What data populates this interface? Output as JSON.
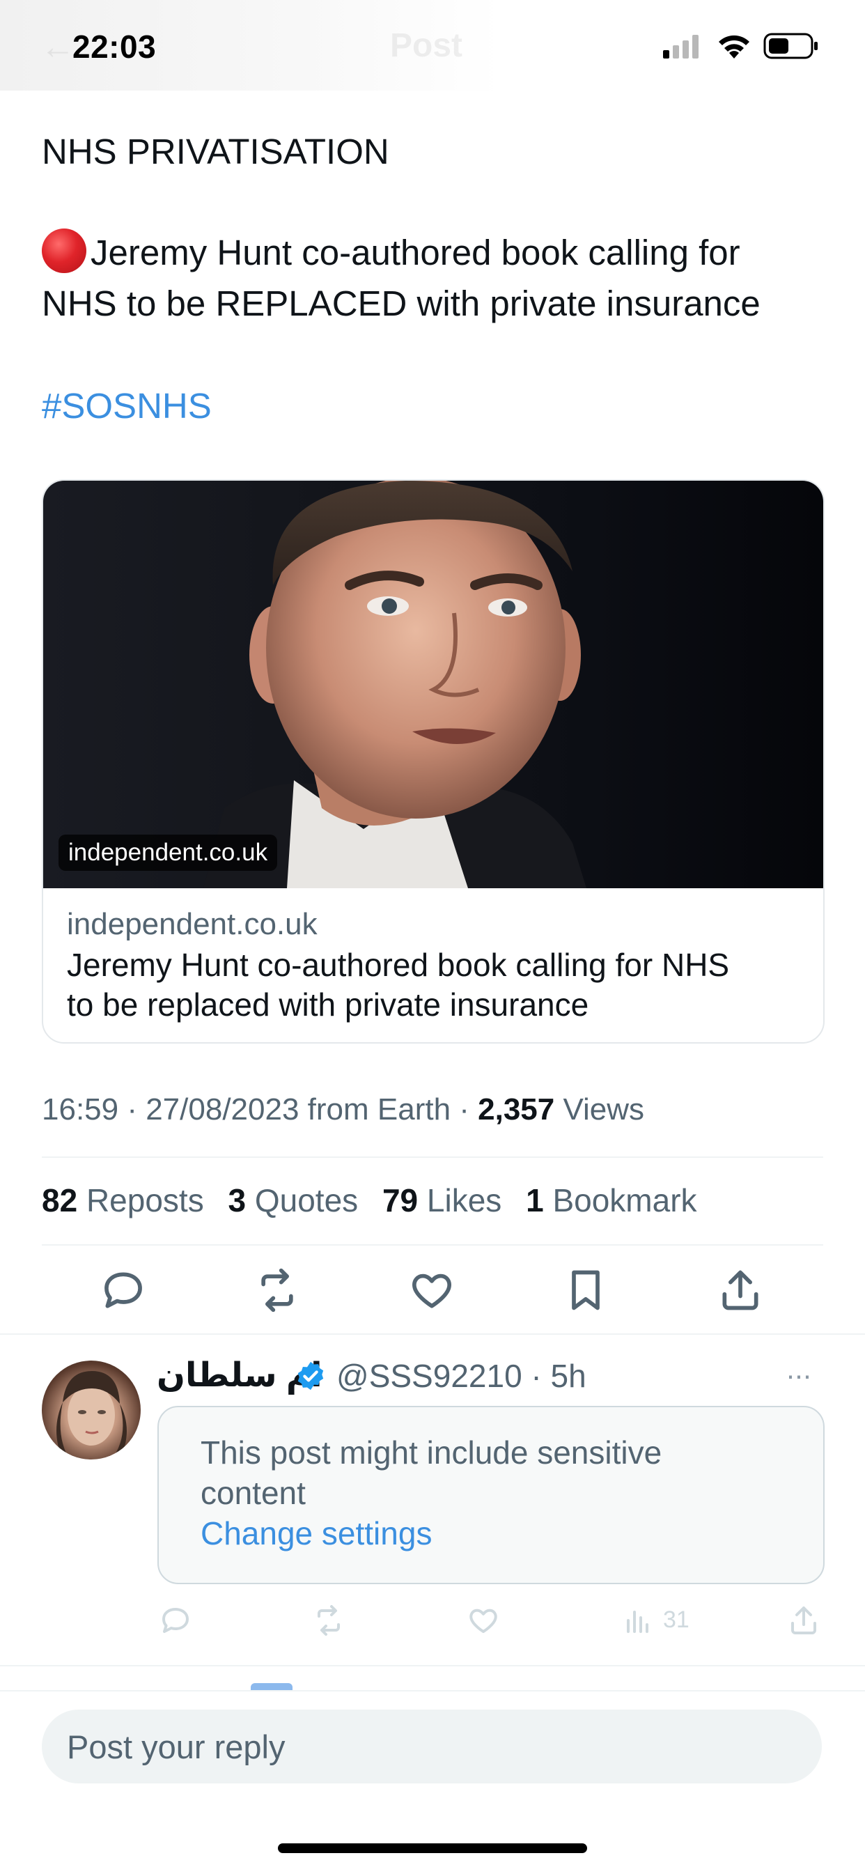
{
  "status_bar": {
    "time": "22:03",
    "faded_title": "Post",
    "icons": [
      "signal-icon",
      "wifi-icon",
      "battery-icon"
    ]
  },
  "tweet": {
    "title": "NHS PRIVATISATION",
    "emoji": "red-circle-icon",
    "body_line_1": "Jeremy Hunt co-authored book calling for",
    "body_line_2": "NHS to be REPLACED with private insurance",
    "hashtag": "#SOSNHS",
    "link_card": {
      "image_badge": "independent.co.uk",
      "domain": "independent.co.uk",
      "title_line_1": "Jeremy Hunt co-authored book calling for NHS",
      "title_line_2": "to be replaced with private insurance"
    },
    "meta": {
      "time_date": "16:59 · 27/08/2023 from Earth · ",
      "views_count": "2,357",
      "views_label": " Views"
    },
    "stats": {
      "reposts_count": "82",
      "reposts_label": "Reposts",
      "quotes_count": "3",
      "quotes_label": "Quotes",
      "likes_count": "79",
      "likes_label": "Likes",
      "bookmarks_count": "1",
      "bookmarks_label": "Bookmark"
    },
    "actions": [
      "reply-icon",
      "repost-icon",
      "like-icon",
      "bookmark-icon",
      "share-icon"
    ]
  },
  "reply": {
    "name": "ام سلطان",
    "handle_time": "@SSS92210 · 5h",
    "more": "···",
    "sensitive_line_1": "This post might include sensitive",
    "sensitive_line_2": "content",
    "change_settings": "Change settings",
    "views_count": "31"
  },
  "composer": {
    "placeholder": "Post your reply"
  },
  "colors": {
    "accent": "#3b8fe0",
    "text": "#0f1419",
    "secondary": "#536471",
    "verified": "#1d9bf0"
  }
}
